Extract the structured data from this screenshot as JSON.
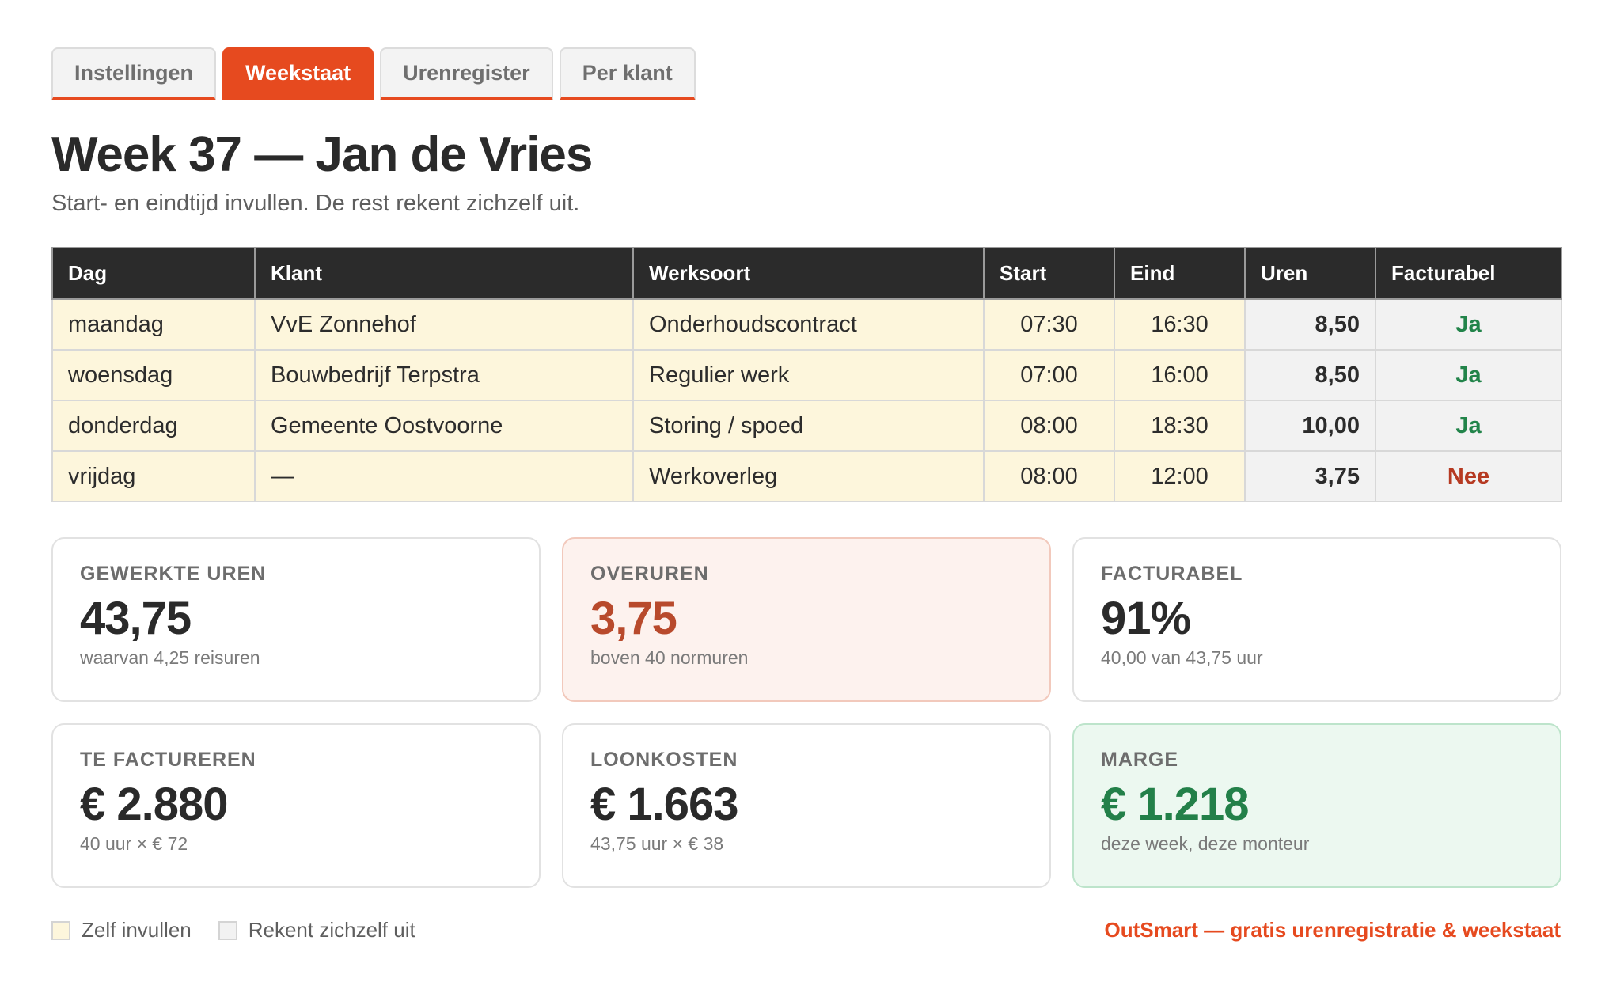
{
  "tabs": [
    {
      "label": "Instellingen",
      "active": false
    },
    {
      "label": "Weekstaat",
      "active": true
    },
    {
      "label": "Urenregister",
      "active": false
    },
    {
      "label": "Per klant",
      "active": false
    }
  ],
  "header": {
    "title": "Week 37 — Jan de Vries",
    "subtitle": "Start- en eindtijd invullen. De rest rekent zichzelf uit."
  },
  "table": {
    "columns": [
      "Dag",
      "Klant",
      "Werksoort",
      "Start",
      "Eind",
      "Uren",
      "Facturabel"
    ],
    "rows": [
      {
        "dag": "maandag",
        "klant": "VvE Zonnehof",
        "werksoort": "Onderhoudscontract",
        "start": "07:30",
        "eind": "16:30",
        "uren": "8,50",
        "facturabel": "Ja"
      },
      {
        "dag": "woensdag",
        "klant": "Bouwbedrijf Terpstra",
        "werksoort": "Regulier werk",
        "start": "07:00",
        "eind": "16:00",
        "uren": "8,50",
        "facturabel": "Ja"
      },
      {
        "dag": "donderdag",
        "klant": "Gemeente Oostvoorne",
        "werksoort": "Storing / spoed",
        "start": "08:00",
        "eind": "18:30",
        "uren": "10,00",
        "facturabel": "Ja"
      },
      {
        "dag": "vrijdag",
        "klant": "—",
        "werksoort": "Werkoverleg",
        "start": "08:00",
        "eind": "12:00",
        "uren": "3,75",
        "facturabel": "Nee"
      }
    ]
  },
  "cards": [
    {
      "label": "GEWERKTE UREN",
      "value": "43,75",
      "sub": "waarvan 4,25 reisuren"
    },
    {
      "label": "OVERUREN",
      "value": "3,75",
      "sub": "boven 40 normuren"
    },
    {
      "label": "FACTURABEL",
      "value": "91%",
      "sub": "40,00 van 43,75 uur"
    },
    {
      "label": "TE FACTUREREN",
      "value": "€ 2.880",
      "sub": "40 uur × € 72"
    },
    {
      "label": "LOONKOSTEN",
      "value": "€ 1.663",
      "sub": "43,75 uur × € 38"
    },
    {
      "label": "MARGE",
      "value": "€ 1.218",
      "sub": "deze week, deze monteur"
    }
  ],
  "legend": {
    "input_label": "Zelf invullen",
    "calc_label": "Rekent zichzelf uit"
  },
  "brand": "OutSmart — gratis urenregistratie & weekstaat",
  "colors": {
    "accent": "#e64a1f",
    "input_cell": "#fdf6dc",
    "calc_cell": "#f2f2f2",
    "positive": "#22844a",
    "negative": "#b63a22"
  }
}
